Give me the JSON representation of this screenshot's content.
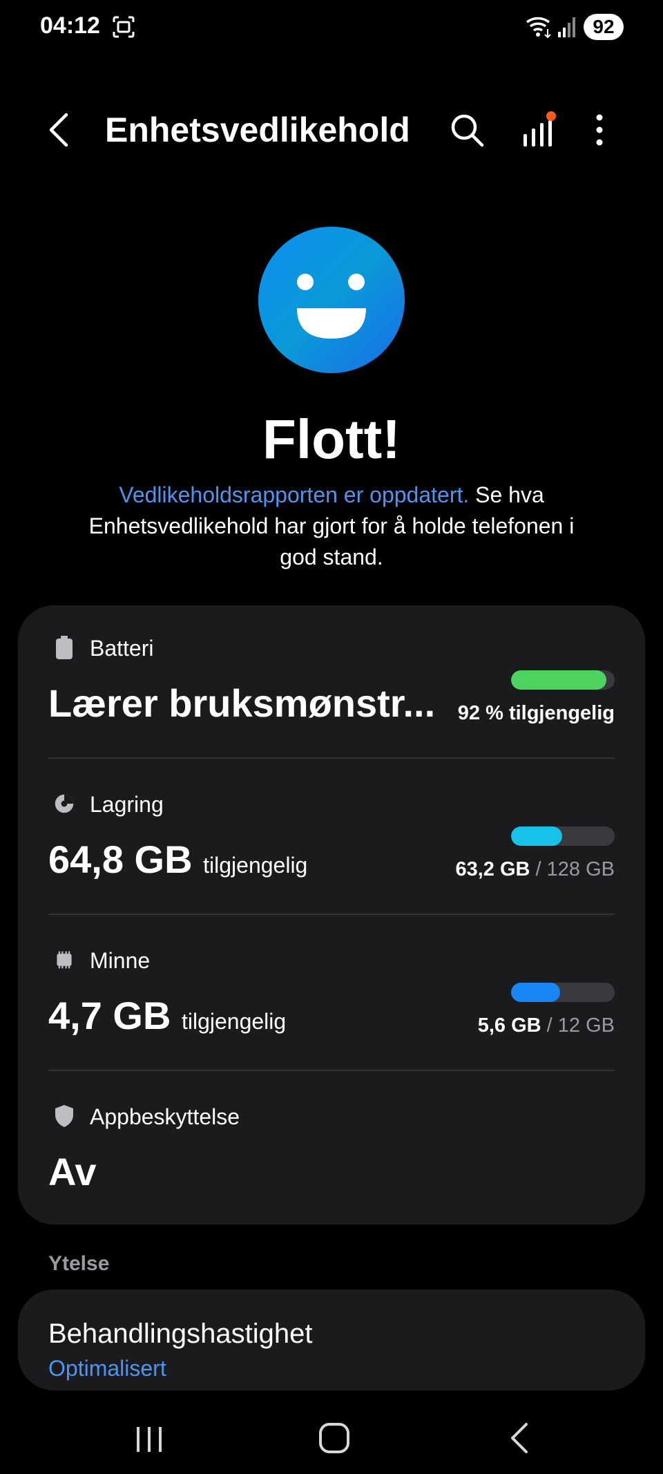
{
  "status_bar": {
    "time": "04:12",
    "battery_level": "92"
  },
  "app_bar": {
    "title": "Enhetsvedlikehold"
  },
  "hero": {
    "title": "Flott!",
    "link_text": "Vedlikeholdsrapporten er oppdatert.",
    "description": " Se hva Enhetsvedlikehold har gjort for å holde telefonen i god stand."
  },
  "items": [
    {
      "label": "Batteri",
      "value": "Lærer bruksmønstr...",
      "unit": "",
      "meta_strong": "92 % tilgjengelig",
      "meta_rest": "",
      "bar_percent": 92,
      "bar_color": "#4cd45f"
    },
    {
      "label": "Lagring",
      "value": "64,8 GB",
      "unit": "tilgjengelig",
      "meta_strong": "63,2 GB",
      "meta_rest": " / 128 GB",
      "bar_percent": 49,
      "bar_color": "#16c2e8"
    },
    {
      "label": "Minne",
      "value": "4,7 GB",
      "unit": "tilgjengelig",
      "meta_strong": "5,6 GB",
      "meta_rest": " / 12 GB",
      "bar_percent": 47,
      "bar_color": "#1a86f5"
    },
    {
      "label": "Appbeskyttelse",
      "value": "Av"
    }
  ],
  "performance": {
    "section_label": "Ytelse",
    "title": "Behandlingshastighet",
    "status": "Optimalisert"
  },
  "colors": {
    "accent": "#4d95f0",
    "background": "#000000",
    "card": "#1b1b1d"
  }
}
